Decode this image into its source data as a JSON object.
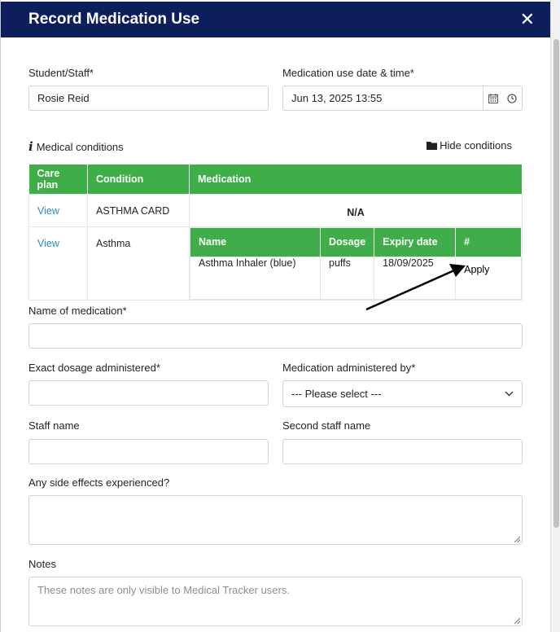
{
  "header": {
    "title": "Record Medication Use",
    "close_symbol": "✕"
  },
  "form": {
    "student_label": "Student/Staff*",
    "student_value": "Rosie Reid",
    "datetime_label": "Medication use date & time*",
    "datetime_value": "Jun 13, 2025 13:55",
    "conditions_heading": "Medical conditions",
    "hide_conditions": "Hide conditions",
    "name_label": "Name of medication*",
    "dosage_label": "Exact dosage administered*",
    "administered_by_label": "Medication administered by*",
    "administered_by_selected": "--- Please select ---",
    "staff_name_label": "Staff name",
    "second_staff_label": "Second staff name",
    "side_effects_label": "Any side effects experienced?",
    "notes_label": "Notes",
    "notes_placeholder": "These notes are only visible to Medical Tracker users."
  },
  "conditions_table": {
    "headers": [
      "Care plan",
      "Condition",
      "Medication"
    ],
    "rows": [
      {
        "care_plan": "View",
        "condition": "ASTHMA CARD",
        "medication": "N/A"
      },
      {
        "care_plan": "View",
        "condition": "Asthma"
      }
    ],
    "med_headers": [
      "Name",
      "Dosage",
      "Expiry date",
      "#"
    ],
    "med_row": {
      "name": "Asthma Inhaler (blue)",
      "dosage": "puffs",
      "expiry": "18/09/2025",
      "action": "Apply"
    }
  },
  "colors": {
    "header_bg": "#0c1f5c",
    "table_header_bg": "#3fae49",
    "link": "#2a8bc5"
  },
  "icons": [
    "close-icon",
    "calendar-icon",
    "clock-icon",
    "info-icon",
    "folder-icon",
    "chevron-down-icon",
    "arrow-annotation"
  ]
}
